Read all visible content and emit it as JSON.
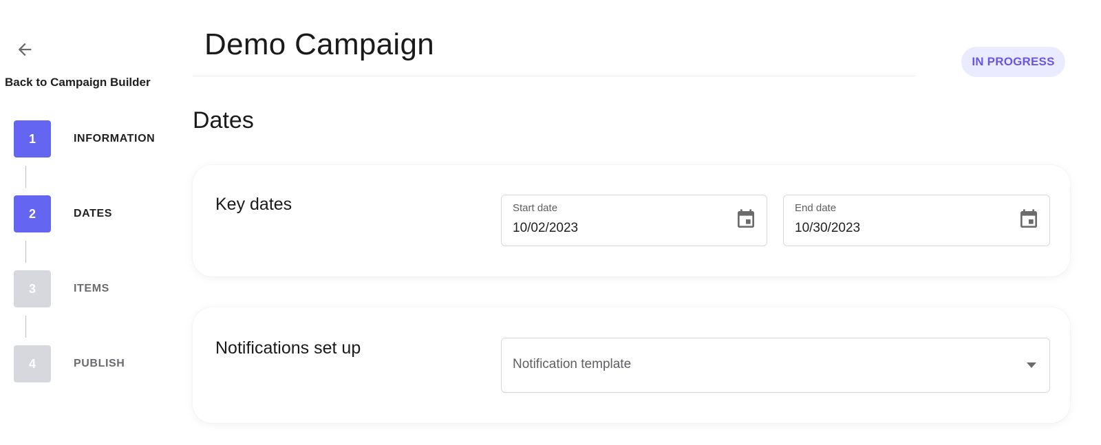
{
  "sidebar": {
    "back_icon": "arrow-left-icon",
    "back_label": "Back to Campaign Builder",
    "steps": [
      {
        "number": "1",
        "label": "INFORMATION",
        "state": "complete"
      },
      {
        "number": "2",
        "label": "DATES",
        "state": "active"
      },
      {
        "number": "3",
        "label": "ITEMS",
        "state": "inactive"
      },
      {
        "number": "4",
        "label": "PUBLISH",
        "state": "inactive"
      }
    ]
  },
  "header": {
    "title": "Demo Campaign",
    "status": "IN PROGRESS"
  },
  "section": {
    "heading": "Dates"
  },
  "key_dates": {
    "title": "Key dates",
    "start": {
      "label": "Start date",
      "value": "10/02/2023",
      "icon": "calendar-icon"
    },
    "end": {
      "label": "End date",
      "value": "10/30/2023",
      "icon": "calendar-icon"
    }
  },
  "notifications": {
    "title": "Notifications set up",
    "template_placeholder": "Notification template",
    "icon": "caret-down-icon"
  },
  "colors": {
    "accent": "#6466f1",
    "inactive_step": "#d6d8de",
    "badge_bg": "#ebebff",
    "badge_text": "#6a55e6"
  }
}
